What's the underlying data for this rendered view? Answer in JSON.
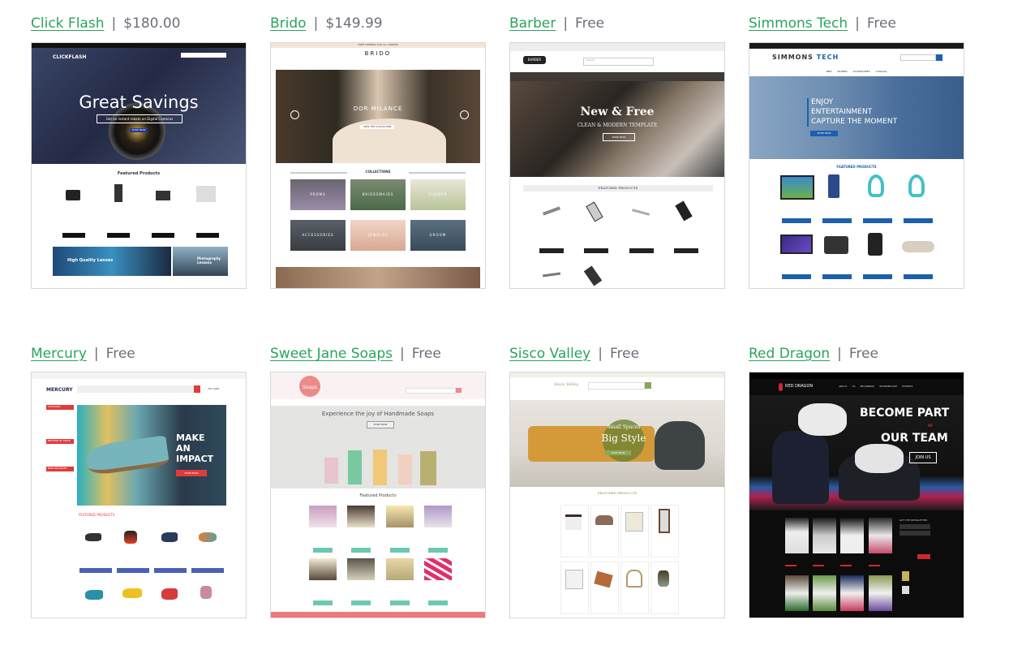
{
  "themes": [
    {
      "name": "Click Flash",
      "price": "$180.00",
      "preview": {
        "brand": "CLICKFLASH",
        "headline": "Great Savings",
        "subline": "Get an instant rebate on Digital Cameras",
        "cta": "SHOP NOW",
        "section": "Featured Products",
        "banner_left": "High Quality Lenses",
        "banner_right": "Photography Lessons"
      }
    },
    {
      "name": "Brido",
      "price": "$149.99",
      "preview": {
        "brand": "BRIDO",
        "topbar": "FREE SHIPPING FOR ALL ORDERS",
        "headline": "DOR MILANCE",
        "cta": "VIEW THE COLLECTION",
        "section": "COLLECTIONS",
        "collections": [
          "PROMS",
          "BRIDESMAIDS",
          "FLOWER",
          "ACCESSORIES",
          "JEWELRY",
          "GROOM"
        ]
      }
    },
    {
      "name": "Barber",
      "price": "Free",
      "preview": {
        "brand": "BARBER",
        "search": "Search",
        "headline": "New & Free",
        "subline": "CLEAN & MODERN TEMPLATE",
        "cta": "SHOP NOW",
        "section": "FEATURED PRODUCTS"
      }
    },
    {
      "name": "Simmons Tech",
      "price": "Free",
      "preview": {
        "brand_a": "SIMMONS",
        "brand_b": "TECH",
        "headline": [
          "ENJOY",
          "ENTERTAINMENT",
          "CAPTURE THE MOMENT"
        ],
        "cta": "SHOP NOW",
        "section": "FEATURED PRODUCTS",
        "nav": [
          "MEN",
          "WOMEN",
          "ACCESSORIES",
          "CATALOG"
        ]
      }
    },
    {
      "name": "Mercury",
      "price": "Free",
      "preview": {
        "brand": "MERCURY",
        "cart": "MY CART",
        "headline": [
          "MAKE",
          "AN",
          "IMPACT"
        ],
        "cta": "SHOP NOW",
        "section": "FEATURED PRODUCTS",
        "sidebar": [
          "CATEGORY",
          "BROWSE BY PRICE",
          "NEW RELEASES"
        ]
      }
    },
    {
      "name": "Sweet Jane Soaps",
      "price": "Free",
      "preview": {
        "brand": "Soaps",
        "headline": "Experience the joy of Handmade Soaps",
        "cta": "SHOP NOW",
        "section": "Featured Products"
      }
    },
    {
      "name": "Sisco Valley",
      "price": "Free",
      "preview": {
        "brand": "Sisco Valley",
        "headline_small": "Small Spaces",
        "headline": "Big Style",
        "cta": "SHOP NOW",
        "section": "FEATURED PRODUCTS"
      }
    },
    {
      "name": "Red Dragon",
      "price": "Free",
      "preview": {
        "brand": "RED DRAGON",
        "nav": [
          "ABOUT US",
          "BEGINNERS",
          "INTERMEDIATE",
          "EXPERTS"
        ],
        "headline_a": "BECOME PART",
        "headline_of": "OF",
        "headline_b": "OUR TEAM",
        "cta": "JOIN US",
        "sidebar": "GET THE NEWSLETTER"
      }
    }
  ],
  "colors": {
    "link": "#2aa45c",
    "price": "#6b6f78",
    "separator": "|"
  }
}
